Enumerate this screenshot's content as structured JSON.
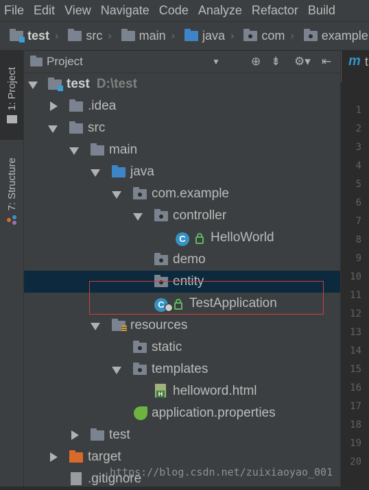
{
  "menu": [
    "File",
    "Edit",
    "View",
    "Navigate",
    "Code",
    "Analyze",
    "Refactor",
    "Build"
  ],
  "breadcrumb": [
    {
      "label": "test",
      "icon": "project-folder-icon"
    },
    {
      "label": "src",
      "icon": "folder-icon"
    },
    {
      "label": "main",
      "icon": "folder-icon"
    },
    {
      "label": "java",
      "icon": "source-folder-icon"
    },
    {
      "label": "com",
      "icon": "package-icon"
    },
    {
      "label": "example",
      "icon": "package-icon"
    }
  ],
  "sidebar": {
    "project_tab": "1: Project",
    "structure_tab": "7: Structure"
  },
  "panel": {
    "title": "Project",
    "dropdown": "▼",
    "icons": [
      "locate-icon",
      "collapse-icon",
      "gear-icon",
      "hide-icon"
    ]
  },
  "tree": [
    {
      "label": "test",
      "hint": "D:\\test",
      "icon": "project-folder-icon",
      "expanded": true
    },
    {
      "label": ".idea",
      "icon": "folder-icon",
      "expanded": false
    },
    {
      "label": "src",
      "icon": "folder-icon",
      "expanded": true
    },
    {
      "label": "main",
      "icon": "folder-icon",
      "expanded": true
    },
    {
      "label": "java",
      "icon": "source-folder-icon",
      "expanded": true
    },
    {
      "label": "com.example",
      "icon": "package-icon",
      "expanded": true
    },
    {
      "label": "controller",
      "icon": "package-icon",
      "expanded": true
    },
    {
      "label": "HelloWorld",
      "icon": "class-icon",
      "class_letter": "C"
    },
    {
      "label": "demo",
      "icon": "package-icon"
    },
    {
      "label": "entity",
      "icon": "package-icon",
      "selected": true
    },
    {
      "label": "TestApplication",
      "icon": "spring-boot-class-icon",
      "class_letter": "C"
    },
    {
      "label": "resources",
      "icon": "resources-folder-icon",
      "expanded": true
    },
    {
      "label": "static",
      "icon": "package-icon"
    },
    {
      "label": "templates",
      "icon": "package-icon",
      "expanded": true
    },
    {
      "label": "helloword.html",
      "icon": "html-file-icon",
      "html_letter": "H"
    },
    {
      "label": "application.properties",
      "icon": "spring-properties-icon"
    },
    {
      "label": "test",
      "icon": "folder-icon",
      "expanded": false
    },
    {
      "label": "target",
      "icon": "excluded-folder-icon",
      "expanded": false
    },
    {
      "label": ".gitignore",
      "icon": "text-file-icon"
    }
  ],
  "editor": {
    "tab_logo": "m",
    "tab_label": "t",
    "line_numbers": [
      "1",
      "2",
      "3",
      "4",
      "5",
      "6",
      "7",
      "8",
      "9",
      "10",
      "11",
      "12",
      "13",
      "14",
      "15",
      "16",
      "17",
      "18",
      "19",
      "20"
    ]
  },
  "watermark": "https://blog.csdn.net/zuixiaoyao_001",
  "colors": {
    "selection": "#0d293e",
    "highlight_box": "#d33d3d",
    "source_folder": "#3d85c6",
    "excluded_folder": "#d86a2a"
  }
}
